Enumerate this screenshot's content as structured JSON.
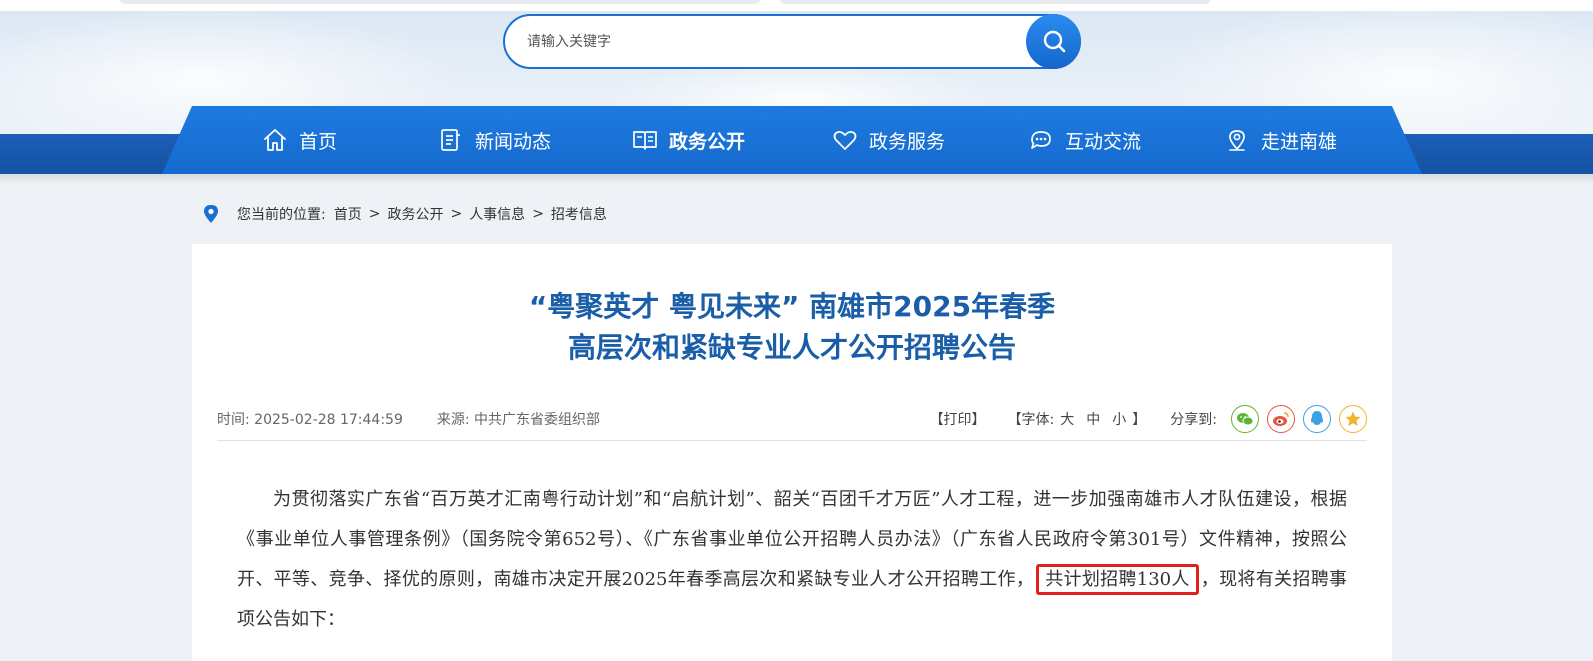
{
  "search": {
    "placeholder": "请输入关键字"
  },
  "nav": [
    {
      "label": "首页",
      "icon": "home-icon"
    },
    {
      "label": "新闻动态",
      "icon": "news-icon"
    },
    {
      "label": "政务公开",
      "icon": "book-icon",
      "active": true
    },
    {
      "label": "政务服务",
      "icon": "heart-icon"
    },
    {
      "label": "互动交流",
      "icon": "chat-icon"
    },
    {
      "label": "走进南雄",
      "icon": "location-icon"
    }
  ],
  "breadcrumb": {
    "prefix": "您当前的位置:",
    "items": [
      "首页",
      "政务公开",
      "人事信息",
      "招考信息"
    ],
    "separator": ">"
  },
  "article": {
    "title_line1": "“粤聚英才 粤见未来” 南雄市2025年春季",
    "title_line2": "高层次和紧缺专业人才公开招聘公告",
    "time_label": "时间:",
    "time": "2025-02-28 17:44:59",
    "source_label": "来源:",
    "source": "中共广东省委组织部",
    "print_label": "【打印】",
    "font_label": "【字体:",
    "font_large": "大",
    "font_medium": "中",
    "font_small": "小",
    "font_close": "】",
    "share_label": "分享到:",
    "body_before": "为贯彻落实广东省“百万英才汇南粤行动计划”和“启航计划”、韶关“百团千才万匠”人才工程，进一步加强南雄市人才队伍建设，根据《事业单位人事管理条例》（国务院令第652号）、《广东省事业单位公开招聘人员办法》（广东省人民政府令第301号）文件精神，按照公开、平等、竞争、择优的原则，南雄市决定开展2025年春季高层次和紧缺专业人才公开招聘工作，",
    "body_highlight": "共计划招聘130人",
    "body_after": "，现将有关招聘事项公告如下："
  },
  "colors": {
    "nav_blue": "#1f7ae0",
    "title_blue": "#1a5ea8",
    "highlight_red": "#e0201c",
    "wechat": "#5cb531",
    "weibo": "#e8553e",
    "qq": "#3aa1e4",
    "qzone": "#f0b42d"
  }
}
